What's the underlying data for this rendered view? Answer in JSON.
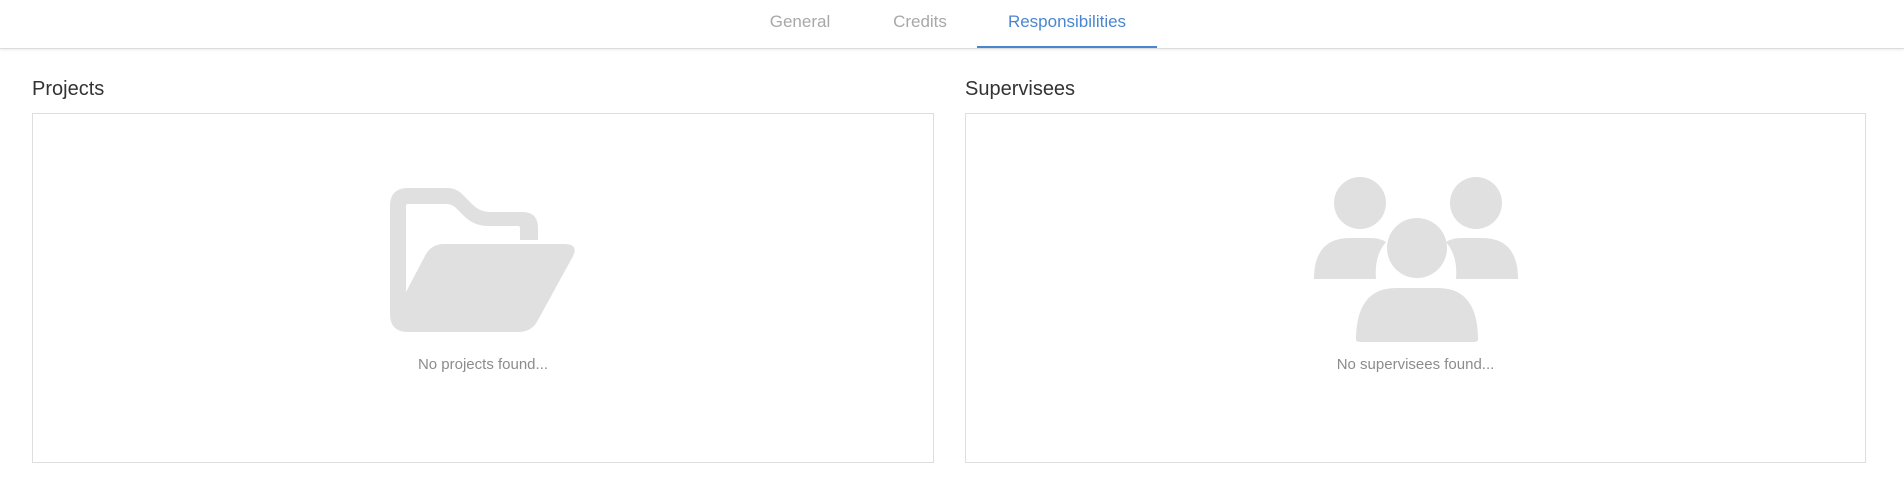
{
  "tabs": [
    {
      "label": "General",
      "active": false
    },
    {
      "label": "Credits",
      "active": false
    },
    {
      "label": "Responsibilities",
      "active": true
    }
  ],
  "projects": {
    "title": "Projects",
    "empty_icon": "folder-open-icon",
    "empty_text": "No projects found..."
  },
  "supervisees": {
    "title": "Supervisees",
    "empty_icon": "users-icon",
    "empty_text": "No supervisees found..."
  },
  "colors": {
    "accent": "#4a86d0",
    "inactive_tab": "#a8a8a8",
    "icon_gray": "#e0e0e0",
    "empty_text": "#8c8c8c",
    "border": "#dedede"
  }
}
